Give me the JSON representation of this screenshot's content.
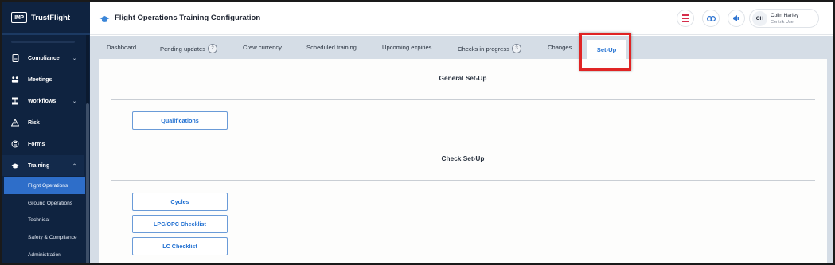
{
  "sidebar": {
    "logo_box": "IMP",
    "logo_text": "TrustFlight",
    "items": [
      {
        "label": "Compliance",
        "icon": "compliance-icon",
        "chevron": "⌄"
      },
      {
        "label": "Meetings",
        "icon": "meetings-icon"
      },
      {
        "label": "Workflows",
        "icon": "workflows-icon",
        "chevron": "⌄"
      },
      {
        "label": "Risk",
        "icon": "risk-icon"
      },
      {
        "label": "Forms",
        "icon": "forms-icon"
      },
      {
        "label": "Training",
        "icon": "training-icon",
        "chevron": "⌃"
      }
    ],
    "sub_items": [
      {
        "label": "Flight Operations",
        "selected": true
      },
      {
        "label": "Ground Operations"
      },
      {
        "label": "Technical"
      },
      {
        "label": "Safety & Compliance"
      },
      {
        "label": "Administration"
      }
    ]
  },
  "header": {
    "title": "Flight Operations Training Configuration",
    "user": {
      "initials": "CH",
      "name": "Colin Harley",
      "role": "Centrik User"
    }
  },
  "tabs": [
    {
      "label": "Dashboard"
    },
    {
      "label": "Pending updates",
      "count": "2"
    },
    {
      "label": "Crew currency"
    },
    {
      "label": "Scheduled training"
    },
    {
      "label": "Upcoming expiries"
    },
    {
      "label": "Checks in progress",
      "count": "3"
    },
    {
      "label": "Changes"
    },
    {
      "label": "Set-Up",
      "active": true
    }
  ],
  "main": {
    "general_title": "General Set-Up",
    "general_buttons": [
      "Qualifications"
    ],
    "check_title": "Check Set-Up",
    "check_buttons": [
      "Cycles",
      "LPC/OPC Checklist",
      "LC Checklist"
    ]
  },
  "colors": {
    "sidebar_bg": "#0f2340",
    "accent": "#1f6fd1",
    "highlight": "#e02424",
    "tabbar_bg": "#d5dde6"
  }
}
